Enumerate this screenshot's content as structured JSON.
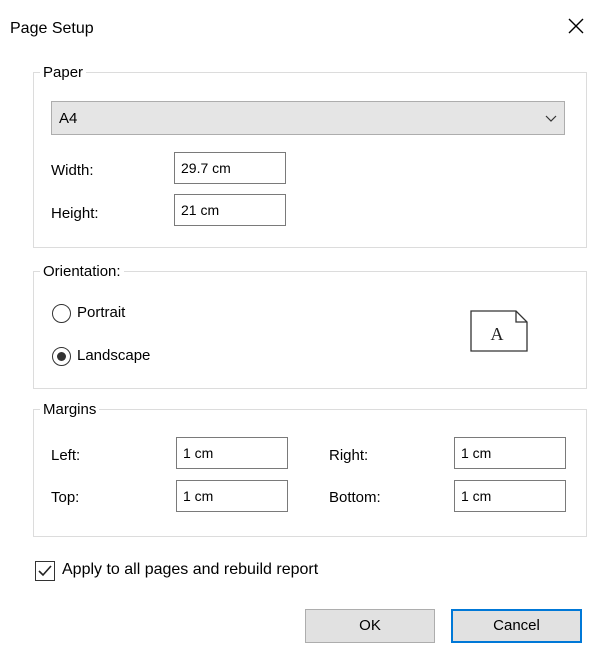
{
  "window": {
    "title": "Page Setup"
  },
  "paper": {
    "legend": "Paper",
    "size_selected": "A4",
    "width_label": "Width:",
    "width_value": "29.7 cm",
    "height_label": "Height:",
    "height_value": "21 cm"
  },
  "orientation": {
    "legend": "Orientation:",
    "portrait_label": "Portrait",
    "landscape_label": "Landscape",
    "selected": "Landscape",
    "preview_letter": "A"
  },
  "margins": {
    "legend": "Margins",
    "left_label": "Left:",
    "left_value": "1 cm",
    "right_label": "Right:",
    "right_value": "1 cm",
    "top_label": "Top:",
    "top_value": "1 cm",
    "bottom_label": "Bottom:",
    "bottom_value": "1 cm"
  },
  "apply_all": {
    "label": "Apply to all pages and rebuild report",
    "checked": true
  },
  "buttons": {
    "ok": "OK",
    "cancel": "Cancel"
  },
  "colors": {
    "accent": "#0078d7",
    "button_bg": "#e1e1e1",
    "group_border": "#dcdcdc"
  }
}
